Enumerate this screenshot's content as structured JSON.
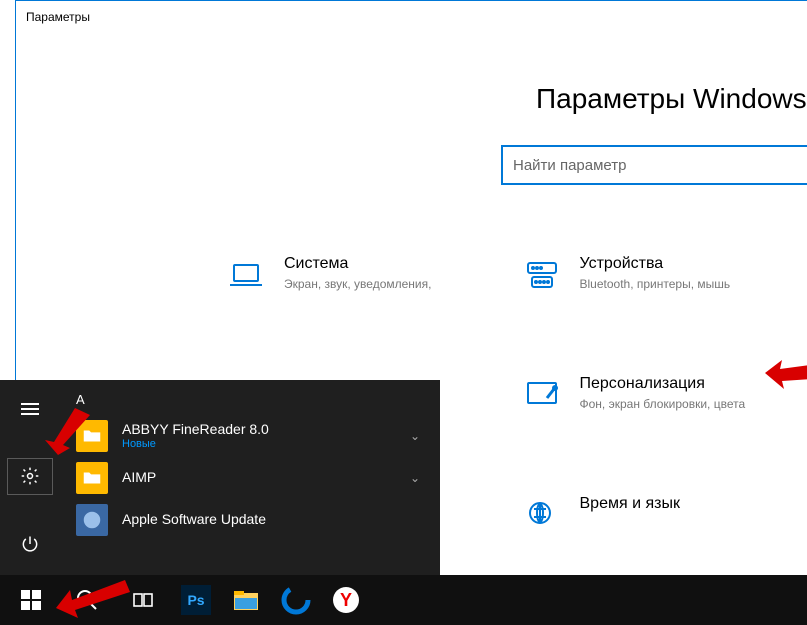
{
  "window": {
    "title": "Параметры"
  },
  "page": {
    "heading": "Параметры Windows"
  },
  "search": {
    "placeholder": "Найти параметр"
  },
  "categories": {
    "system": {
      "title": "Система",
      "desc": "Экран, звук, уведомления,"
    },
    "devices": {
      "title": "Устройства",
      "desc": "Bluetooth, принтеры, мышь"
    },
    "personalization": {
      "title": "Персонализация",
      "desc": "Фон, экран блокировки, цвета"
    },
    "time": {
      "title": "Время и язык",
      "desc": ""
    }
  },
  "start": {
    "letter": "A",
    "apps": [
      {
        "name": "ABBYY FineReader 8.0",
        "sub": "Новые",
        "icon": "folder",
        "expand": true
      },
      {
        "name": "AIMP",
        "icon": "folder",
        "expand": true
      },
      {
        "name": "Apple Software Update",
        "icon": "update"
      }
    ]
  }
}
